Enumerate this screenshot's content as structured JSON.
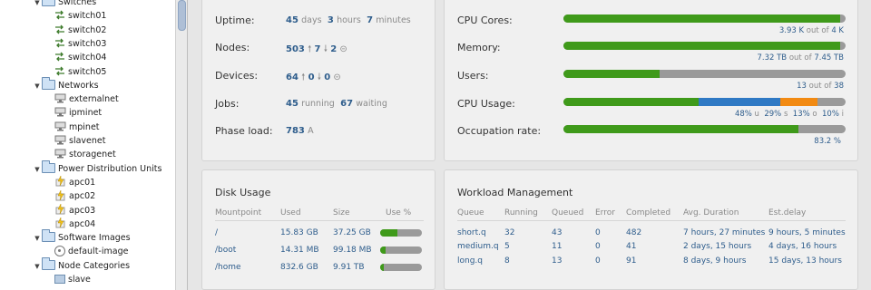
{
  "sidebar": {
    "items": [
      {
        "label": "Switches",
        "type": "folder",
        "level": 1
      },
      {
        "label": "switch01",
        "type": "switch",
        "level": 2
      },
      {
        "label": "switch02",
        "type": "switch",
        "level": 2
      },
      {
        "label": "switch03",
        "type": "switch",
        "level": 2
      },
      {
        "label": "switch04",
        "type": "switch",
        "level": 2
      },
      {
        "label": "switch05",
        "type": "switch",
        "level": 2
      },
      {
        "label": "Networks",
        "type": "folder",
        "level": 1
      },
      {
        "label": "externalnet",
        "type": "network",
        "level": 2
      },
      {
        "label": "ipminet",
        "type": "network",
        "level": 2
      },
      {
        "label": "mpinet",
        "type": "network",
        "level": 2
      },
      {
        "label": "slavenet",
        "type": "network",
        "level": 2
      },
      {
        "label": "storagenet",
        "type": "network",
        "level": 2
      },
      {
        "label": "Power Distribution Units",
        "type": "folder",
        "level": 1
      },
      {
        "label": "apc01",
        "type": "pdu",
        "level": 2
      },
      {
        "label": "apc02",
        "type": "pdu",
        "level": 2
      },
      {
        "label": "apc03",
        "type": "pdu",
        "level": 2
      },
      {
        "label": "apc04",
        "type": "pdu",
        "level": 2
      },
      {
        "label": "Software Images",
        "type": "folder",
        "level": 1
      },
      {
        "label": "default-image",
        "type": "image",
        "level": 2
      },
      {
        "label": "Node Categories",
        "type": "folder",
        "level": 1
      },
      {
        "label": "slave",
        "type": "category",
        "level": 2
      }
    ]
  },
  "overview": {
    "uptime": {
      "label": "Uptime:",
      "days": "45",
      "days_unit": "days",
      "hours": "3",
      "hours_unit": "hours",
      "minutes": "7",
      "minutes_unit": "minutes"
    },
    "nodes": {
      "label": "Nodes:",
      "total": "503",
      "up": "7",
      "down": "2"
    },
    "devices": {
      "label": "Devices:",
      "total": "64",
      "up": "0",
      "down": "0"
    },
    "jobs": {
      "label": "Jobs:",
      "running": "45",
      "running_unit": "running",
      "waiting": "67",
      "waiting_unit": "waiting"
    },
    "phase_load": {
      "label": "Phase load:",
      "value": "783",
      "unit": "A"
    }
  },
  "resources": {
    "cpu_cores": {
      "label": "CPU Cores:",
      "used": "3.93 K",
      "out_of": "out of",
      "total": "4 K",
      "fraction": 0.98
    },
    "memory": {
      "label": "Memory:",
      "used": "7.32 TB",
      "out_of": "out of",
      "total": "7.45 TB",
      "fraction": 0.98
    },
    "users": {
      "label": "Users:",
      "used": "13",
      "out_of": "out of",
      "total": "38",
      "fraction": 0.34
    },
    "cpu_usage": {
      "label": "CPU Usage:",
      "user_pct": "48%",
      "user_unit": "u",
      "system_pct": "29%",
      "system_unit": "s",
      "other_pct": "13%",
      "other_unit": "o",
      "idle_pct": "10%",
      "idle_unit": "i",
      "user": 0.48,
      "system": 0.29,
      "other": 0.13
    },
    "occupation_rate": {
      "label": "Occupation rate:",
      "value": "83.2 %",
      "fraction": 0.832
    }
  },
  "disk": {
    "title": "Disk Usage",
    "headers": [
      "Mountpoint",
      "Used",
      "Size",
      "Use %"
    ],
    "rows": [
      {
        "mountpoint": "/",
        "used": "15.83 GB",
        "size": "37.25 GB",
        "pct": 0.42
      },
      {
        "mountpoint": "/boot",
        "used": "14.31 MB",
        "size": "99.18 MB",
        "pct": 0.14
      },
      {
        "mountpoint": "/home",
        "used": "832.6 GB",
        "size": "9.91 TB",
        "pct": 0.08
      }
    ]
  },
  "workload": {
    "title": "Workload Management",
    "headers": [
      "Queue",
      "Running",
      "Queued",
      "Error",
      "Completed",
      "Avg. Duration",
      "Est.delay"
    ],
    "rows": [
      [
        "short.q",
        "32",
        "43",
        "0",
        "482",
        "7 hours, 27 minutes",
        "9 hours, 5 minutes"
      ],
      [
        "medium.q",
        "5",
        "11",
        "0",
        "41",
        "2 days, 15 hours",
        "4 days, 16 hours"
      ],
      [
        "long.q",
        "8",
        "13",
        "0",
        "91",
        "8 days, 9 hours",
        "15 days, 13 hours"
      ]
    ]
  },
  "colors": {
    "green": "#3f9a1a",
    "blue": "#2f79c4",
    "orange": "#f28a12",
    "gray": "#9a9a9a",
    "link": "#2e5d8c"
  }
}
